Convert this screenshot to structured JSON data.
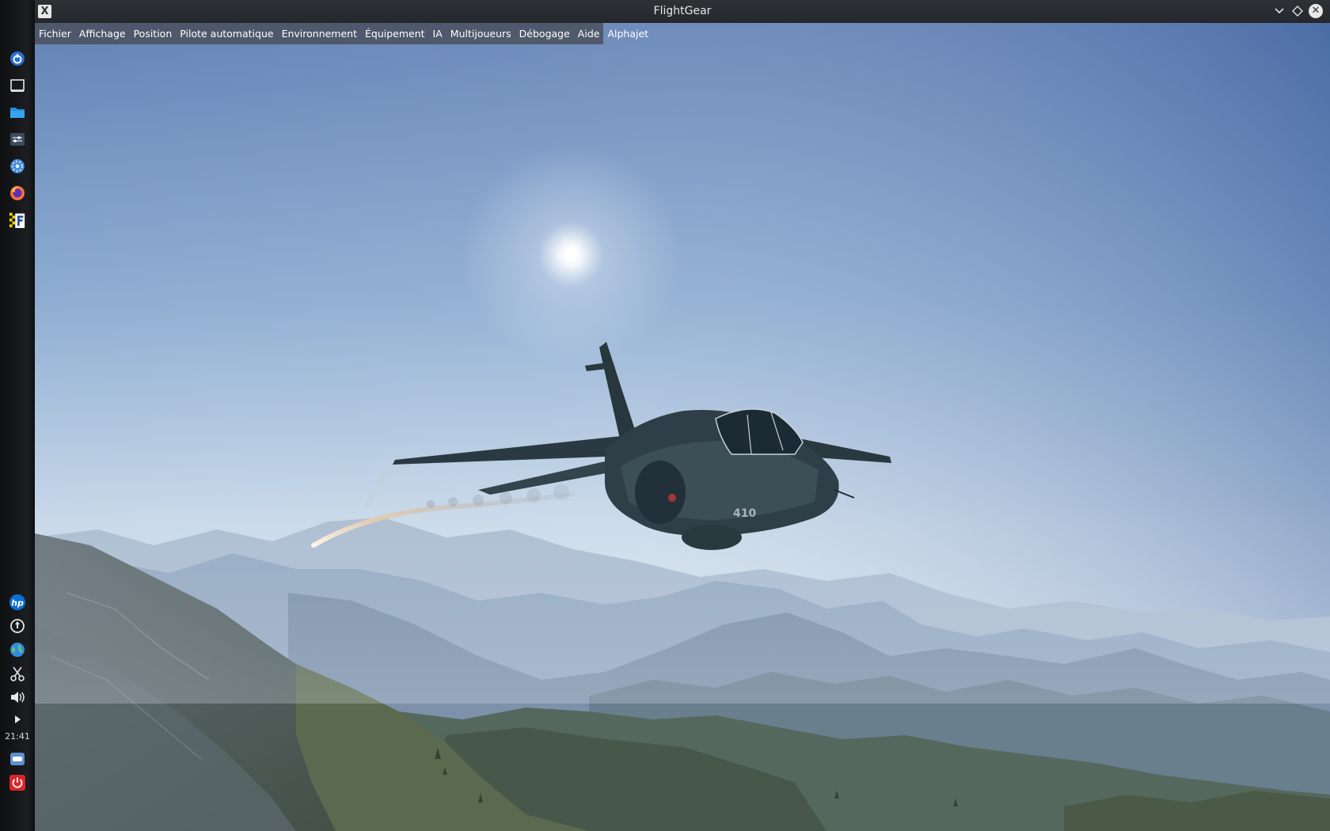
{
  "window": {
    "title": "FlightGear"
  },
  "menubar": {
    "items": [
      "Fichier",
      "Affichage",
      "Position",
      "Pilote automatique",
      "Environnement",
      "Équipement",
      "IA",
      "Multijoueurs",
      "Débogage",
      "Aide",
      "Alphajet"
    ]
  },
  "dock": {
    "clock": "21:41",
    "top_icons": [
      "power-ring-icon",
      "window-icon",
      "folder-icon",
      "settings-panel-icon",
      "gear-icon",
      "firefox-icon",
      "flightgear-icon"
    ],
    "bottom_icons": [
      "hp-icon",
      "update-icon",
      "network-globe-icon",
      "scissors-icon",
      "volume-icon",
      "play-arrow-icon"
    ],
    "tray_icons": [
      "drive-icon",
      "shutdown-icon"
    ]
  },
  "scene": {
    "aircraft_marking": "410",
    "colors": {
      "sky_top": "#4f6fa6",
      "sky_horizon": "#c9d9ea",
      "mountain_far": "#8ea4bf",
      "mountain_near": "#4e5f55",
      "aircraft": "#2b3a42"
    }
  }
}
